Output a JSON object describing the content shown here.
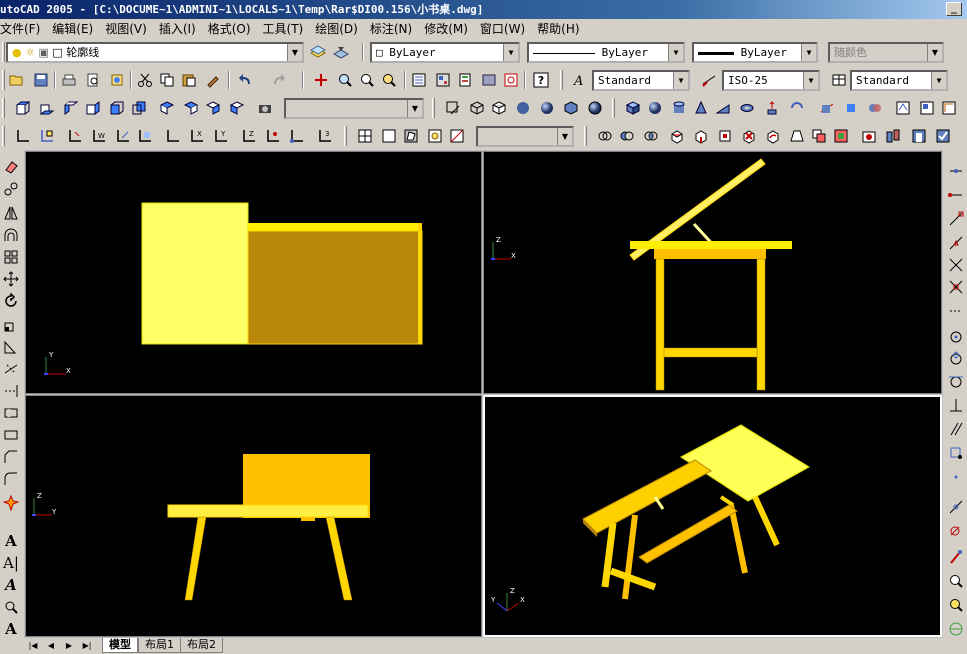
{
  "window": {
    "title": "utoCAD 2005 - [C:\\DOCUME~1\\ADMINI~1\\LOCALS~1\\Temp\\Rar$DI00.156\\小书桌.dwg]",
    "min_glyph": "_"
  },
  "menu": [
    "文件(F)",
    "编辑(E)",
    "视图(V)",
    "插入(I)",
    "格式(O)",
    "工具(T)",
    "绘图(D)",
    "标注(N)",
    "修改(M)",
    "窗口(W)",
    "帮助(H)"
  ],
  "toolbar": {
    "layer_value": "轮廓线",
    "color_value": "ByLayer",
    "linetype_value": "ByLayer",
    "lineweight_value": "ByLayer",
    "plotstyle_value": "随颜色",
    "text_style_value": "Standard",
    "dim_style_value": "ISO-25",
    "table_style_value": "Standard",
    "view_combo_value": "",
    "ucs_combo_value": ""
  },
  "tabs": {
    "model": "模型",
    "layout1": "布局1",
    "layout2": "布局2"
  },
  "colors": {
    "light_yellow": "#ffff66",
    "mid_yellow": "#ffd700",
    "dark_yellow": "#b8860b",
    "viewport_bg": "#000000"
  }
}
